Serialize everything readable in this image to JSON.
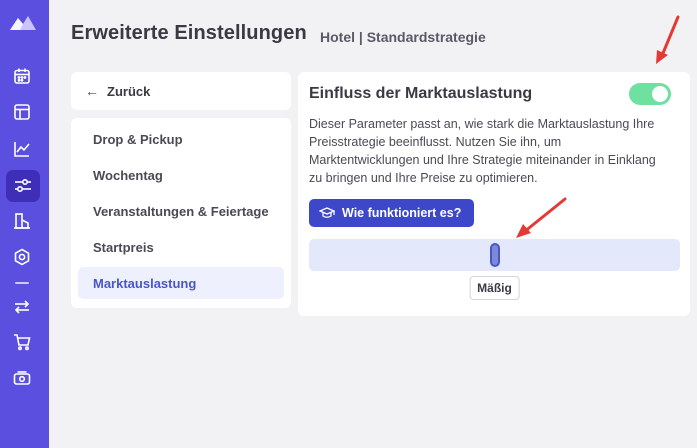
{
  "header": {
    "title": "Erweiterte Einstellungen",
    "subtitle": "Hotel | Standardstrategie"
  },
  "sidebar_nav": {
    "icons": [
      "logo-icon",
      "calendar-icon",
      "layout-icon",
      "chart-icon",
      "sliders-icon",
      "buildings-icon",
      "settings-icon",
      "sync-icon",
      "cart-icon",
      "money-icon"
    ],
    "active": "sliders-icon"
  },
  "back": {
    "label": "Zurück"
  },
  "menu": {
    "items": [
      {
        "label": "Drop & Pickup"
      },
      {
        "label": "Wochentag"
      },
      {
        "label": "Veranstaltungen & Feiertage"
      },
      {
        "label": "Startpreis"
      },
      {
        "label": "Marktauslastung"
      }
    ],
    "active_index": 4
  },
  "panel": {
    "title": "Einfluss der Marktauslastung",
    "toggle_on": true,
    "description": "Dieser Parameter passt an, wie stark die Marktauslastung Ihre Preisstrategie beeinflusst. Nutzen Sie ihn, um Marktentwicklungen und Ihre Strategie miteinander in Einklang zu bringen und Ihre Preise zu optimieren.",
    "help_button": "Wie funktioniert es?",
    "slider": {
      "value_fraction": 0.5,
      "value_label": "Mäßig"
    }
  },
  "colors": {
    "rail": "#5b4fe0",
    "rail_active": "#3f2fb8",
    "accent": "#3d47c9",
    "toggle_on": "#6ee0a0",
    "slider_track": "#e3e9fb",
    "annotation_arrow": "#e53935"
  }
}
